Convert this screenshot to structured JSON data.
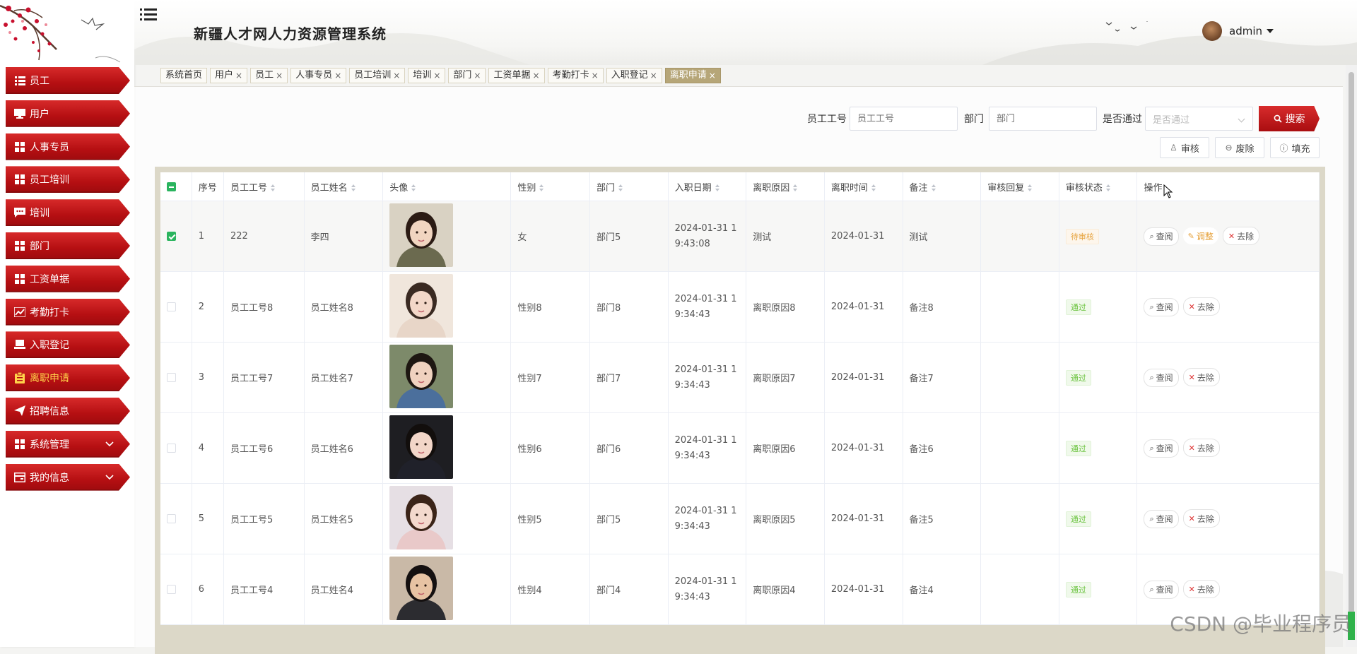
{
  "app": {
    "title": "新疆人才网人力资源管理系统",
    "user": "admin"
  },
  "sidebar": {
    "items": [
      {
        "label": "员工",
        "icon": "list-icon"
      },
      {
        "label": "用户",
        "icon": "monitor-icon"
      },
      {
        "label": "人事专员",
        "icon": "grid-icon"
      },
      {
        "label": "员工培训",
        "icon": "grid-icon"
      },
      {
        "label": "培训",
        "icon": "chat-icon"
      },
      {
        "label": "部门",
        "icon": "grid-icon"
      },
      {
        "label": "工资单据",
        "icon": "grid-icon"
      },
      {
        "label": "考勤打卡",
        "icon": "chart-icon"
      },
      {
        "label": "入职登记",
        "icon": "laptop-icon"
      },
      {
        "label": "离职申请",
        "icon": "clipboard-icon",
        "active": true
      },
      {
        "label": "招聘信息",
        "icon": "send-icon"
      },
      {
        "label": "系统管理",
        "icon": "grid-icon",
        "has_children": true
      },
      {
        "label": "我的信息",
        "icon": "card-icon",
        "has_children": true
      }
    ]
  },
  "tabs": [
    {
      "label": "系统首页",
      "closable": false
    },
    {
      "label": "用户",
      "closable": true
    },
    {
      "label": "员工",
      "closable": true
    },
    {
      "label": "人事专员",
      "closable": true
    },
    {
      "label": "员工培训",
      "closable": true
    },
    {
      "label": "培训",
      "closable": true
    },
    {
      "label": "部门",
      "closable": true
    },
    {
      "label": "工资单据",
      "closable": true
    },
    {
      "label": "考勤打卡",
      "closable": true
    },
    {
      "label": "入职登记",
      "closable": true
    },
    {
      "label": "离职申请",
      "closable": true,
      "active": true
    }
  ],
  "tab_close": "×",
  "search": {
    "emp_no_label": "员工工号",
    "emp_no_placeholder": "员工工号",
    "dept_label": "部门",
    "dept_placeholder": "部门",
    "pass_label": "是否通过",
    "pass_placeholder": "是否通过",
    "search_button": "搜索"
  },
  "toolbar": {
    "review": "审核",
    "delete": "废除",
    "fill": "填充"
  },
  "table": {
    "columns": [
      "序号",
      "员工工号",
      "员工姓名",
      "头像",
      "性别",
      "部门",
      "入职日期",
      "离职原因",
      "离职时间",
      "备注",
      "审核回复",
      "审核状态",
      "操作"
    ],
    "rows": [
      {
        "no": "1",
        "emp_no": "222",
        "name": "李四",
        "gender": "女",
        "dept": "部门5",
        "hire_date_1": "2024-01-31 1",
        "hire_date_2": "9:43:08",
        "reason": "测试",
        "leave_date": "2024-01-31",
        "remark": "测试",
        "reply": "",
        "status": "待审核",
        "checked": true,
        "actions": [
          "查阅",
          "调整",
          "去除"
        ]
      },
      {
        "no": "2",
        "emp_no": "员工工号8",
        "name": "员工姓名8",
        "gender": "性别8",
        "dept": "部门8",
        "hire_date_1": "2024-01-31 1",
        "hire_date_2": "9:34:43",
        "reason": "离职原因8",
        "leave_date": "2024-01-31",
        "remark": "备注8",
        "reply": "",
        "status": "通过",
        "checked": false,
        "actions": [
          "查阅",
          "去除"
        ]
      },
      {
        "no": "3",
        "emp_no": "员工工号7",
        "name": "员工姓名7",
        "gender": "性别7",
        "dept": "部门7",
        "hire_date_1": "2024-01-31 1",
        "hire_date_2": "9:34:43",
        "reason": "离职原因7",
        "leave_date": "2024-01-31",
        "remark": "备注7",
        "reply": "",
        "status": "通过",
        "checked": false,
        "actions": [
          "查阅",
          "去除"
        ]
      },
      {
        "no": "4",
        "emp_no": "员工工号6",
        "name": "员工姓名6",
        "gender": "性别6",
        "dept": "部门6",
        "hire_date_1": "2024-01-31 1",
        "hire_date_2": "9:34:43",
        "reason": "离职原因6",
        "leave_date": "2024-01-31",
        "remark": "备注6",
        "reply": "",
        "status": "通过",
        "checked": false,
        "actions": [
          "查阅",
          "去除"
        ]
      },
      {
        "no": "5",
        "emp_no": "员工工号5",
        "name": "员工姓名5",
        "gender": "性别5",
        "dept": "部门5",
        "hire_date_1": "2024-01-31 1",
        "hire_date_2": "9:34:43",
        "reason": "离职原因5",
        "leave_date": "2024-01-31",
        "remark": "备注5",
        "reply": "",
        "status": "通过",
        "checked": false,
        "actions": [
          "查阅",
          "去除"
        ]
      },
      {
        "no": "6",
        "emp_no": "员工工号4",
        "name": "员工姓名4",
        "gender": "性别4",
        "dept": "部门4",
        "hire_date_1": "2024-01-31 1",
        "hire_date_2": "9:34:43",
        "reason": "离职原因4",
        "leave_date": "2024-01-31",
        "remark": "备注4",
        "reply": "",
        "status": "通过",
        "checked": false,
        "actions": [
          "查阅",
          "去除"
        ]
      }
    ]
  },
  "watermark": "CSDN @毕业程序员",
  "colors": {
    "brand_red": "#b50f12",
    "active_tab": "#b6a678",
    "active_menu_text": "#ffd24a",
    "checkbox": "#2ab45e",
    "pending": "#e6a23c",
    "passed": "#67c23a"
  }
}
